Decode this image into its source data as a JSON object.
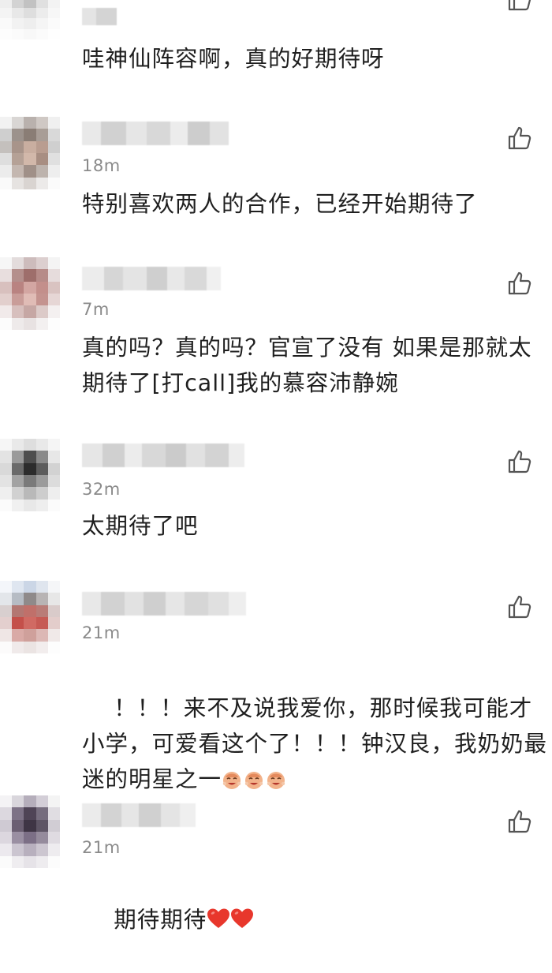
{
  "comments": [
    {
      "time": "",
      "text": "哇神仙阵容啊，真的好期待呀"
    },
    {
      "time": "18m",
      "text": "特别喜欢两人的合作，已经开始期待了"
    },
    {
      "time": "7m",
      "text": "真的吗？真的吗？官宣了没有 如果是那就太期待了[打call]我的慕容沛静婉"
    },
    {
      "time": "32m",
      "text": "太期待了吧"
    },
    {
      "time": "21m",
      "text": "！！！来不及说我爱你，那时候我可能才小学，可爱看这个了！！！钟汉良，我奶奶最迷的明星之一"
    },
    {
      "time": "21m",
      "text": "期待期待"
    }
  ],
  "icons": {
    "like": "thumbs-up-icon",
    "sticker": "laughing-sticker-icon",
    "heart": "red-heart-icon"
  },
  "colors": {
    "text": "#1f1f1f",
    "time": "#8a8a8a",
    "heart": "#e8372c",
    "icon": "#555555"
  }
}
